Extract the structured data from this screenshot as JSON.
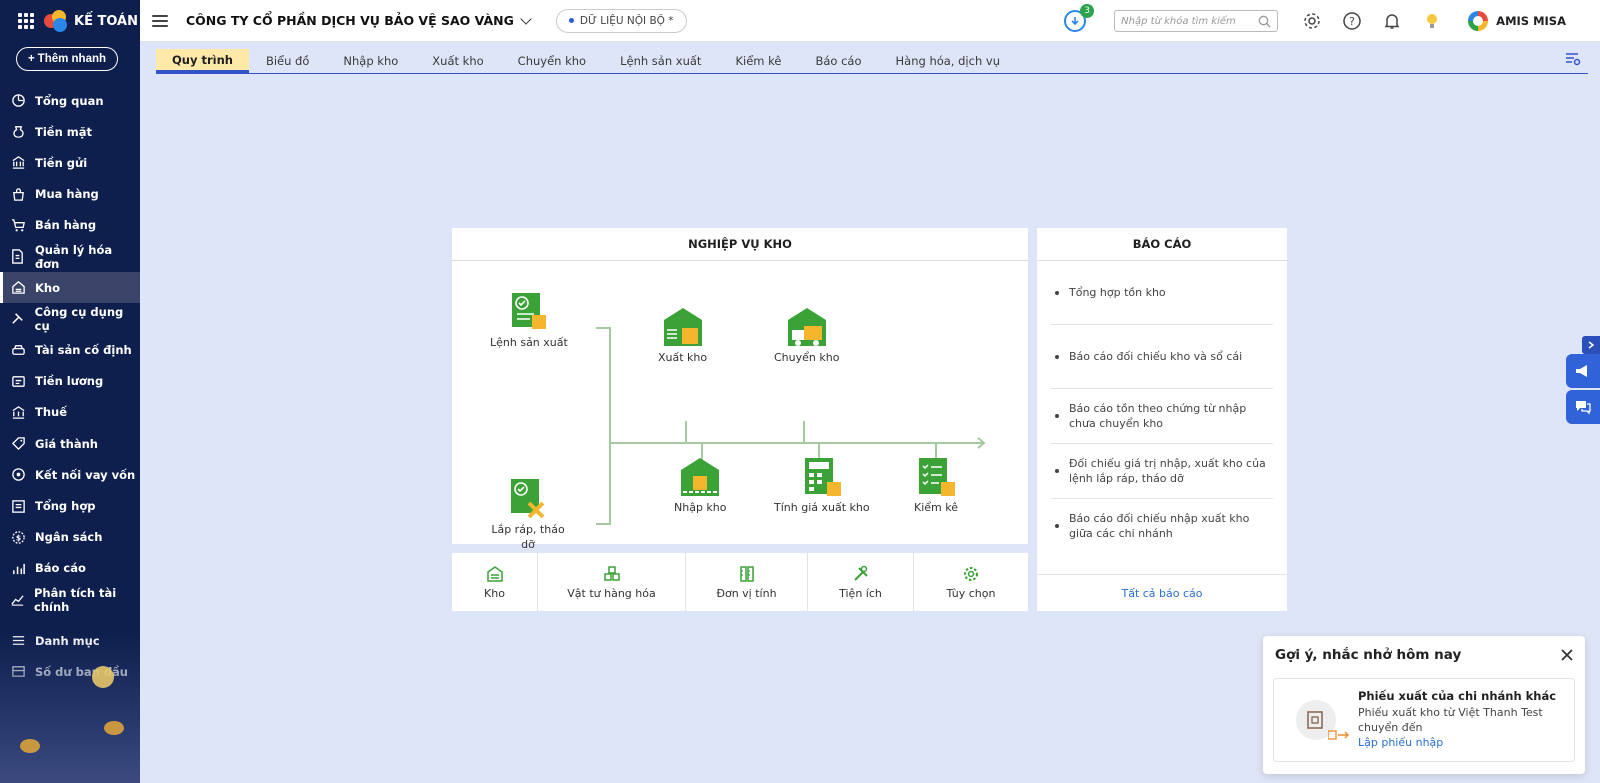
{
  "app": {
    "logo_text": "KẾ TOÁN",
    "quick_add_label": "Thêm nhanh"
  },
  "sidebar": {
    "items": [
      {
        "label": "Tổng quan",
        "icon": "dashboard-icon"
      },
      {
        "label": "Tiền mặt",
        "icon": "money-bag-icon"
      },
      {
        "label": "Tiền gửi",
        "icon": "bank-icon"
      },
      {
        "label": "Mua hàng",
        "icon": "shopping-bag-icon"
      },
      {
        "label": "Bán hàng",
        "icon": "cart-icon"
      },
      {
        "label": "Quản lý hóa đơn",
        "icon": "invoice-icon"
      },
      {
        "label": "Kho",
        "icon": "warehouse-icon",
        "active": true
      },
      {
        "label": "Công cụ dụng cụ",
        "icon": "tools-icon"
      },
      {
        "label": "Tài sản cố định",
        "icon": "car-icon"
      },
      {
        "label": "Tiền lương",
        "icon": "salary-icon"
      },
      {
        "label": "Thuế",
        "icon": "tax-icon"
      },
      {
        "label": "Giá thành",
        "icon": "price-tag-icon"
      },
      {
        "label": "Kết nối vay vốn",
        "icon": "loan-icon"
      },
      {
        "label": "Tổng hợp",
        "icon": "summary-icon"
      },
      {
        "label": "Ngân sách",
        "icon": "budget-icon"
      },
      {
        "label": "Báo cáo",
        "icon": "report-chart-icon"
      },
      {
        "label": "Phân tích tài chính",
        "icon": "analysis-icon"
      }
    ],
    "bottom_items": [
      {
        "label": "Danh mục",
        "icon": "list-icon"
      },
      {
        "label": "Số dư ban đầu",
        "icon": "opening-balance-icon"
      }
    ]
  },
  "header": {
    "company": "CÔNG TY CỔ PHẦN DỊCH VỤ BẢO VỆ SAO VÀNG",
    "data_scope": "DỮ LIỆU NỘI BỘ *",
    "download_badge": "3",
    "search_placeholder": "Nhập từ khóa tìm kiếm",
    "user_name": "AMIS MISA"
  },
  "tabs": [
    {
      "label": "Quy trình",
      "active": true
    },
    {
      "label": "Biểu đồ"
    },
    {
      "label": "Nhập kho"
    },
    {
      "label": "Xuất kho"
    },
    {
      "label": "Chuyển kho"
    },
    {
      "label": "Lệnh sản xuất"
    },
    {
      "label": "Kiểm kê"
    },
    {
      "label": "Báo cáo"
    },
    {
      "label": "Hàng hóa, dịch vụ"
    }
  ],
  "workflow": {
    "title": "NGHIỆP VỤ KHO",
    "nodes": {
      "production_order": "Lệnh sản xuất",
      "assembly": "Lắp ráp, tháo dỡ",
      "export": "Xuất kho",
      "transfer": "Chuyển kho",
      "import": "Nhập kho",
      "export_price": "Tính giá xuất kho",
      "inventory_check": "Kiểm kê"
    }
  },
  "quick_links": [
    {
      "label": "Kho",
      "icon": "warehouse-icon"
    },
    {
      "label": "Vật tư hàng hóa",
      "icon": "boxes-icon"
    },
    {
      "label": "Đơn vị tính",
      "icon": "ruler-icon"
    },
    {
      "label": "Tiện ích",
      "icon": "utility-tools-icon"
    },
    {
      "label": "Tùy chọn",
      "icon": "gear-icon"
    }
  ],
  "reports": {
    "title": "BÁO CÁO",
    "items": [
      "Tổng hợp tồn kho",
      "Báo cáo đối chiếu kho và sổ cái",
      "Báo cáo tồn theo chứng từ nhập chưa chuyển kho",
      "Đối chiếu giá trị nhập, xuất kho của lệnh lắp ráp, tháo dỡ",
      "Báo cáo đối chiếu nhập xuất kho giữa các chi nhánh"
    ],
    "all_link": "Tất cả báo cáo"
  },
  "notification": {
    "title": "Gợi ý, nhắc nhở hôm nay",
    "card_title": "Phiếu xuất của chi nhánh khác",
    "card_desc_1": "Phiếu xuất kho từ Việt Thanh Test",
    "card_desc_2": "chuyển đến",
    "card_action": "Lập phiếu nhập"
  },
  "colors": {
    "sidebar_bg": "#0f1f4d",
    "page_bg": "#dfe5f8",
    "accent_green": "#3aa236",
    "active_tab": "#ffe9a8",
    "link_blue": "#2a6fd1"
  }
}
